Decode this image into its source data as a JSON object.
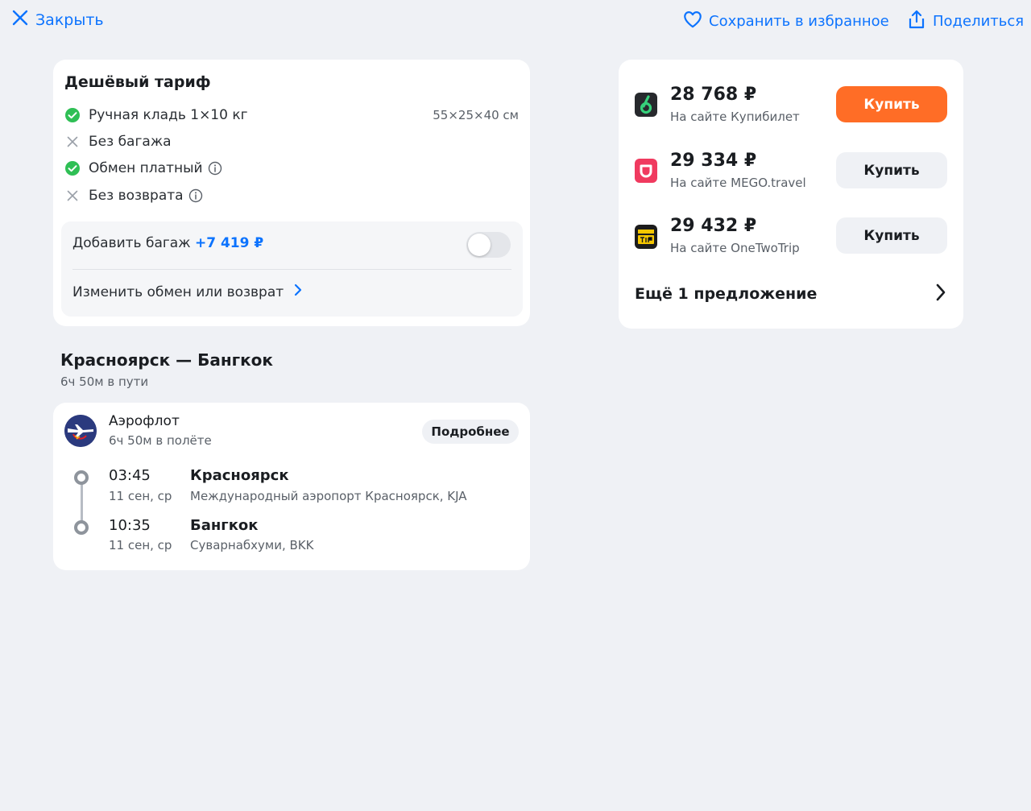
{
  "colors": {
    "accent": "#0c73fe",
    "buy_primary": "#ff6d26",
    "check_green": "#2fbf55",
    "background": "#eff1f5"
  },
  "topbar": {
    "close_label": "Закрыть",
    "favorite_label": "Сохранить в избранное",
    "share_label": "Поделиться"
  },
  "tariff": {
    "title": "Дешёвый тариф",
    "features": [
      {
        "label": "Ручная кладь 1×10 кг",
        "included": true,
        "extra": "55×25×40 см",
        "icon": "check-circle-icon"
      },
      {
        "label": "Без багажа",
        "included": false,
        "icon": "cross-icon"
      },
      {
        "label": "Обмен платный",
        "included": true,
        "info": true,
        "icon": "check-circle-icon"
      },
      {
        "label": "Без возврата",
        "included": false,
        "info": true,
        "icon": "cross-icon"
      }
    ],
    "add_baggage_label": "Добавить багаж",
    "add_baggage_price": "+7 419 ₽",
    "baggage_toggle_on": false,
    "change_label": "Изменить обмен или возврат"
  },
  "route": {
    "title": "Красноярск — Бангкок",
    "subtitle": "6ч 50м в пути"
  },
  "flight": {
    "airline": "Аэрофлот",
    "duration": "6ч 50м в полёте",
    "details_label": "Подробнее",
    "segments": [
      {
        "time": "03:45",
        "date": "11 сен, ср",
        "city": "Красноярск",
        "airport": "Международный аэропорт Красноярск, KJA"
      },
      {
        "time": "10:35",
        "date": "11 сен, ср",
        "city": "Бангкок",
        "airport": "Суварнабхуми, BKK"
      }
    ]
  },
  "offers": {
    "items": [
      {
        "price": "28 768 ₽",
        "site": "На сайте Купибилет",
        "buy_label": "Купить",
        "primary": true,
        "logo": "kupibilet-logo"
      },
      {
        "price": "29 334 ₽",
        "site": "На сайте MEGO.travel",
        "buy_label": "Купить",
        "primary": false,
        "logo": "mego-logo"
      },
      {
        "price": "29 432 ₽",
        "site": "На сайте OneTwoTrip",
        "buy_label": "Купить",
        "primary": false,
        "logo": "onetwotrip-logo"
      }
    ],
    "more_label": "Ещё 1 предложение"
  }
}
